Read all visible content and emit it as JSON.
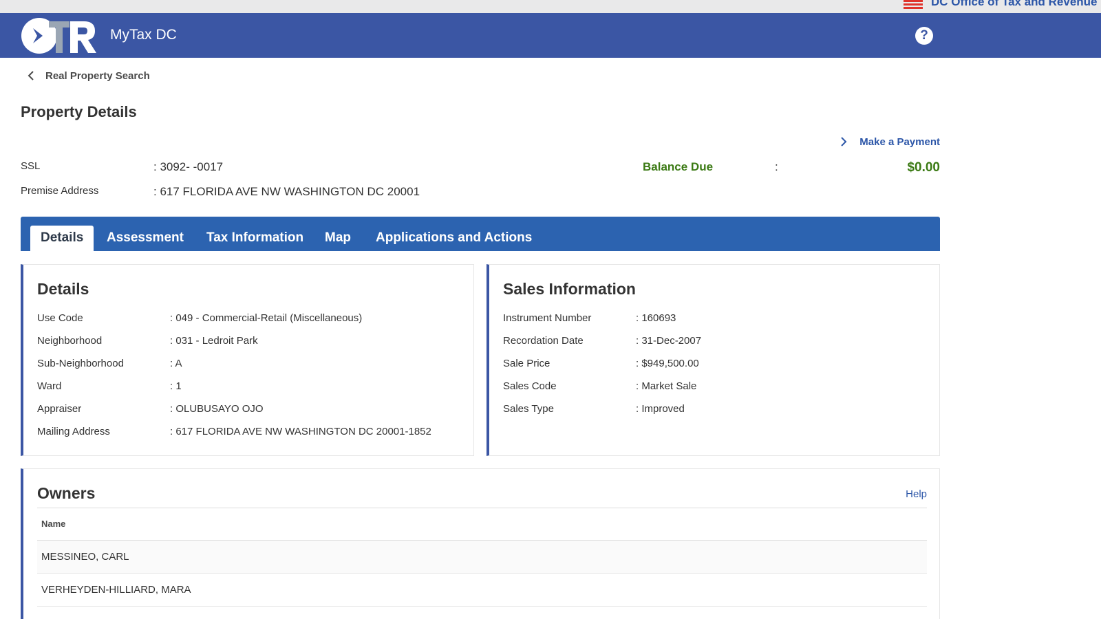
{
  "topbar": {
    "agency": "DC Office of Tax and Revenue"
  },
  "header": {
    "title": "MyTax DC",
    "logo_icon": "otr-logo-icon",
    "help_icon": "question-mark-icon"
  },
  "nav": {
    "back_label": "Real Property Search"
  },
  "page": {
    "title": "Property Details",
    "make_payment": "Make a Payment"
  },
  "summary": {
    "ssl_label": "SSL",
    "ssl_value": ": 3092- -0017",
    "address_label": "Premise Address",
    "address_value": ": 617 FLORIDA AVE NW WASHINGTON DC 20001",
    "balance_label": "Balance Due",
    "balance_colon": ":",
    "balance_value": "$0.00"
  },
  "tabs": [
    {
      "label": "Details",
      "active": true
    },
    {
      "label": "Assessment",
      "active": false
    },
    {
      "label": "Tax Information",
      "active": false
    },
    {
      "label": "Map",
      "active": false
    },
    {
      "label": "Applications and Actions",
      "active": false
    }
  ],
  "details": {
    "title": "Details",
    "rows": [
      {
        "label": "Use Code",
        "value": ": 049 - Commercial-Retail (Miscellaneous)"
      },
      {
        "label": "Neighborhood",
        "value": ": 031 - Ledroit Park"
      },
      {
        "label": "Sub-Neighborhood",
        "value": ": A"
      },
      {
        "label": "Ward",
        "value": ": 1"
      },
      {
        "label": "Appraiser",
        "value": ": OLUBUSAYO OJO"
      },
      {
        "label": "Mailing Address",
        "value": ": 617 FLORIDA AVE NW WASHINGTON DC 20001-1852"
      }
    ]
  },
  "sales": {
    "title": "Sales Information",
    "rows": [
      {
        "label": "Instrument Number",
        "value": ": 160693"
      },
      {
        "label": "Recordation Date",
        "value": ": 31-Dec-2007"
      },
      {
        "label": "Sale Price",
        "value": ": $949,500.00"
      },
      {
        "label": "Sales Code",
        "value": ": Market Sale"
      },
      {
        "label": "Sales Type",
        "value": ": Improved"
      }
    ]
  },
  "owners": {
    "title": "Owners",
    "help": "Help",
    "column": "Name",
    "names": [
      "MESSINEO, CARL",
      "VERHEYDEN-HILLIARD, MARA"
    ]
  },
  "colors": {
    "header": "#3b56a4",
    "tabbar": "#2c63b0",
    "link": "#2c56a8",
    "balance": "#3b7a14"
  }
}
